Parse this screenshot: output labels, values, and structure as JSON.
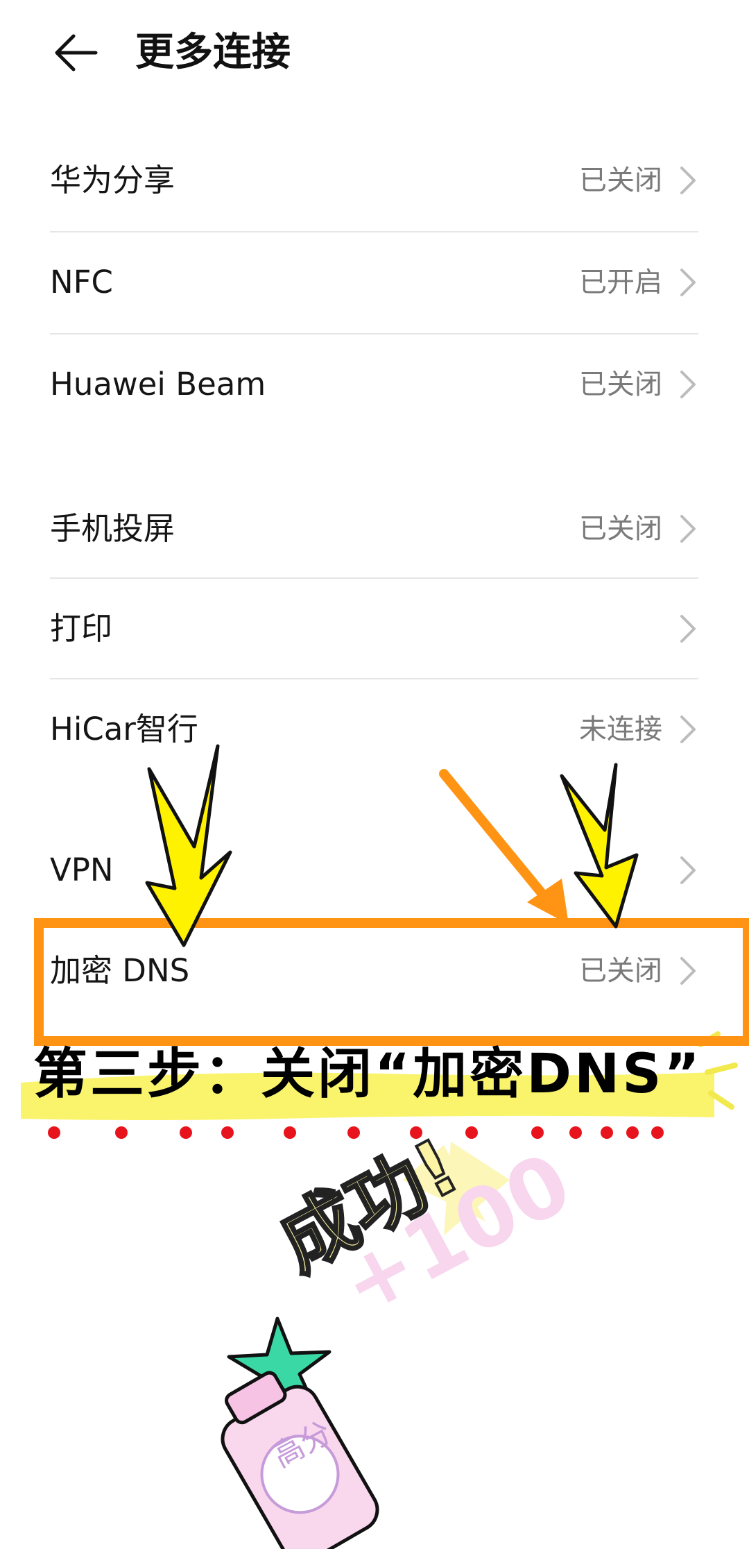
{
  "header": {
    "title": "更多连接",
    "back_icon": "arrow-left-icon"
  },
  "sections": [
    {
      "items": [
        {
          "label": "华为分享",
          "status": "已关闭"
        },
        {
          "label": "NFC",
          "status": "已开启"
        },
        {
          "label": "Huawei Beam",
          "status": "已关闭"
        }
      ]
    },
    {
      "items": [
        {
          "label": "手机投屏",
          "status": "已关闭"
        },
        {
          "label": "打印",
          "status": ""
        },
        {
          "label": "HiCar智行",
          "status": "未连接"
        }
      ]
    },
    {
      "items": [
        {
          "label": "VPN",
          "status": ""
        },
        {
          "label": "加密 DNS",
          "status": "已关闭"
        }
      ]
    }
  ],
  "annotation": {
    "step_caption": "第三步：关闭“加密DNS”",
    "success_text": "成功!",
    "score_text": "+100",
    "bottle_label": "高分",
    "colors": {
      "highlight_box": "#ff9414",
      "arrow_yellow": "#fff200",
      "marker": "#f8f35c",
      "dots": "#e8141d"
    }
  }
}
